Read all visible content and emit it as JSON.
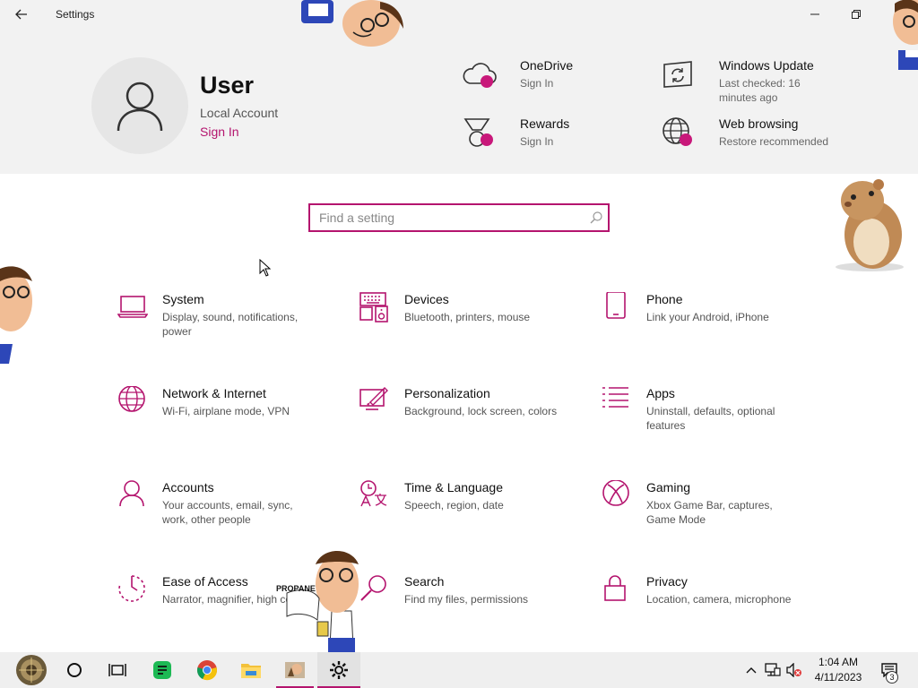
{
  "window": {
    "title": "Settings"
  },
  "account": {
    "name": "User",
    "type": "Local Account",
    "sign_in": "Sign In"
  },
  "services": [
    {
      "title": "OneDrive",
      "subtitle": "Sign In",
      "icon": "cloud-icon"
    },
    {
      "title": "Windows Update",
      "subtitle": "Last checked: 16 minutes ago",
      "icon": "refresh-icon"
    },
    {
      "title": "Rewards",
      "subtitle": "Sign In",
      "icon": "medal-icon"
    },
    {
      "title": "Web browsing",
      "subtitle": "Restore recommended",
      "icon": "globe-icon"
    }
  ],
  "search": {
    "placeholder": "Find a setting"
  },
  "categories": [
    {
      "title": "System",
      "desc": "Display, sound, notifications, power",
      "icon": "laptop-icon"
    },
    {
      "title": "Devices",
      "desc": "Bluetooth, printers, mouse",
      "icon": "keyboard-speaker-icon"
    },
    {
      "title": "Phone",
      "desc": "Link your Android, iPhone",
      "icon": "phone-icon"
    },
    {
      "title": "Network & Internet",
      "desc": "Wi-Fi, airplane mode, VPN",
      "icon": "globe-icon"
    },
    {
      "title": "Personalization",
      "desc": "Background, lock screen, colors",
      "icon": "paint-icon"
    },
    {
      "title": "Apps",
      "desc": "Uninstall, defaults, optional features",
      "icon": "list-icon"
    },
    {
      "title": "Accounts",
      "desc": "Your accounts, email, sync, work, other people",
      "icon": "person-icon"
    },
    {
      "title": "Time & Language",
      "desc": "Speech, region, date",
      "icon": "language-icon"
    },
    {
      "title": "Gaming",
      "desc": "Xbox Game Bar, captures, Game Mode",
      "icon": "xbox-icon"
    },
    {
      "title": "Ease of Access",
      "desc": "Narrator, magnifier, high contrast",
      "icon": "timer-icon"
    },
    {
      "title": "Search",
      "desc": "Find my files, permissions",
      "icon": "search-icon"
    },
    {
      "title": "Privacy",
      "desc": "Location, camera, microphone",
      "icon": "lock-icon"
    }
  ],
  "stickers": {
    "propane_label": "PROPANE"
  },
  "taskbar": {
    "time": "1:04 AM",
    "date": "4/11/2023",
    "notifications": "3"
  },
  "colors": {
    "accent": "#b4146e",
    "dot": "#c8187a",
    "header_bg": "#f2f2f2"
  }
}
